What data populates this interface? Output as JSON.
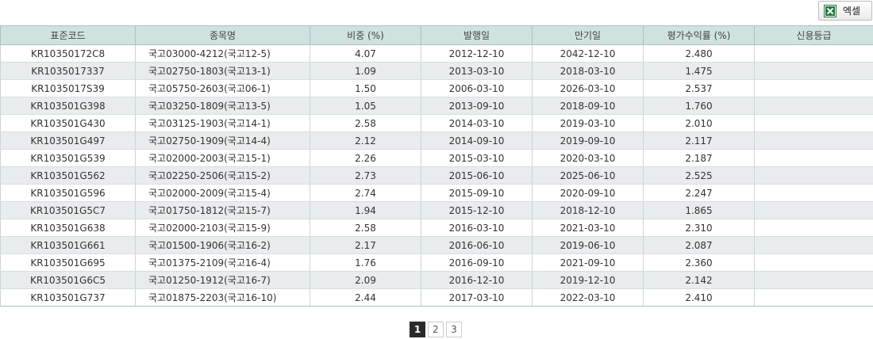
{
  "toolbar": {
    "excel_label": "엑셀",
    "excel_icon": "excel-icon"
  },
  "colors": {
    "header_bg": "#cfe2e0",
    "row_alt_bg": "#e8ecec",
    "excel_green": "#1f7a3a",
    "pager_active": "#2b2b2b"
  },
  "table": {
    "columns": [
      "표준코드",
      "종목명",
      "비중 (%)",
      "발행일",
      "만기일",
      "평가수익률 (%)",
      "신용등급"
    ],
    "rows": [
      [
        "KR10350172C8",
        "국고03000-4212(국고12-5)",
        "4.07",
        "2012-12-10",
        "2042-12-10",
        "2.480",
        ""
      ],
      [
        "KR1035017337",
        "국고02750-1803(국고13-1)",
        "1.09",
        "2013-03-10",
        "2018-03-10",
        "1.475",
        ""
      ],
      [
        "KR1035017S39",
        "국고05750-2603(국고06-1)",
        "1.50",
        "2006-03-10",
        "2026-03-10",
        "2.537",
        ""
      ],
      [
        "KR103501G398",
        "국고03250-1809(국고13-5)",
        "1.05",
        "2013-09-10",
        "2018-09-10",
        "1.760",
        ""
      ],
      [
        "KR103501G430",
        "국고03125-1903(국고14-1)",
        "2.58",
        "2014-03-10",
        "2019-03-10",
        "2.010",
        ""
      ],
      [
        "KR103501G497",
        "국고02750-1909(국고14-4)",
        "2.12",
        "2014-09-10",
        "2019-09-10",
        "2.117",
        ""
      ],
      [
        "KR103501G539",
        "국고02000-2003(국고15-1)",
        "2.26",
        "2015-03-10",
        "2020-03-10",
        "2.187",
        ""
      ],
      [
        "KR103501G562",
        "국고02250-2506(국고15-2)",
        "2.73",
        "2015-06-10",
        "2025-06-10",
        "2.525",
        ""
      ],
      [
        "KR103501G596",
        "국고02000-2009(국고15-4)",
        "2.74",
        "2015-09-10",
        "2020-09-10",
        "2.247",
        ""
      ],
      [
        "KR103501G5C7",
        "국고01750-1812(국고15-7)",
        "1.94",
        "2015-12-10",
        "2018-12-10",
        "1.865",
        ""
      ],
      [
        "KR103501G638",
        "국고02000-2103(국고15-9)",
        "2.58",
        "2016-03-10",
        "2021-03-10",
        "2.310",
        ""
      ],
      [
        "KR103501G661",
        "국고01500-1906(국고16-2)",
        "2.17",
        "2016-06-10",
        "2019-06-10",
        "2.087",
        ""
      ],
      [
        "KR103501G695",
        "국고01375-2109(국고16-4)",
        "1.76",
        "2016-09-10",
        "2021-09-10",
        "2.360",
        ""
      ],
      [
        "KR103501G6C5",
        "국고01250-1912(국고16-7)",
        "2.09",
        "2016-12-10",
        "2019-12-10",
        "2.142",
        ""
      ],
      [
        "KR103501G737",
        "국고01875-2203(국고16-10)",
        "2.44",
        "2017-03-10",
        "2022-03-10",
        "2.410",
        ""
      ]
    ]
  },
  "pagination": {
    "pages": [
      "1",
      "2",
      "3"
    ],
    "current": "1"
  }
}
